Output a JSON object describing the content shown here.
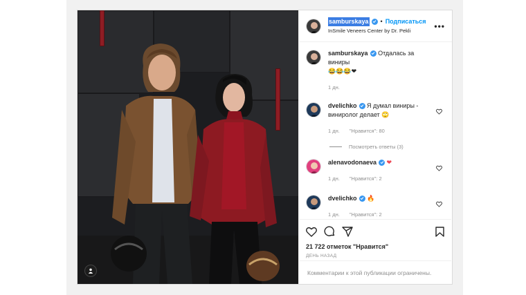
{
  "header": {
    "username": "samburskaya",
    "follow_label": "Подписаться",
    "location": "InSmile Veneers Center by Dr. Pekli"
  },
  "caption": {
    "username": "samburskaya",
    "text": "Отдалась за виниры",
    "emojis": "😂😂😂❤",
    "time": "1 дн."
  },
  "comments": [
    {
      "username": "dvelichko",
      "text": "Я думал виниры - винирολог делает 🙄",
      "time": "1 дн.",
      "likes": "\"Нравится\": 80"
    },
    {
      "username": "alenavodonaeva",
      "text": "❤",
      "time": "1 дн.",
      "likes": "\"Нравится\": 2"
    },
    {
      "username": "dvelichko",
      "text": "🔥",
      "time": "1 дн.",
      "likes": "\"Нравится\": 2"
    }
  ],
  "view_replies": "Посмотреть ответы (3)",
  "likes_count": "21 722 отметок \"Нравится\"",
  "posted_ago": "ДЕНЬ НАЗАД",
  "comments_disabled": "Комментарии к этой публикации ограничены.",
  "colors": {
    "link": "#0095f6",
    "verified": "#3897f0",
    "heart": "#ed4956"
  }
}
